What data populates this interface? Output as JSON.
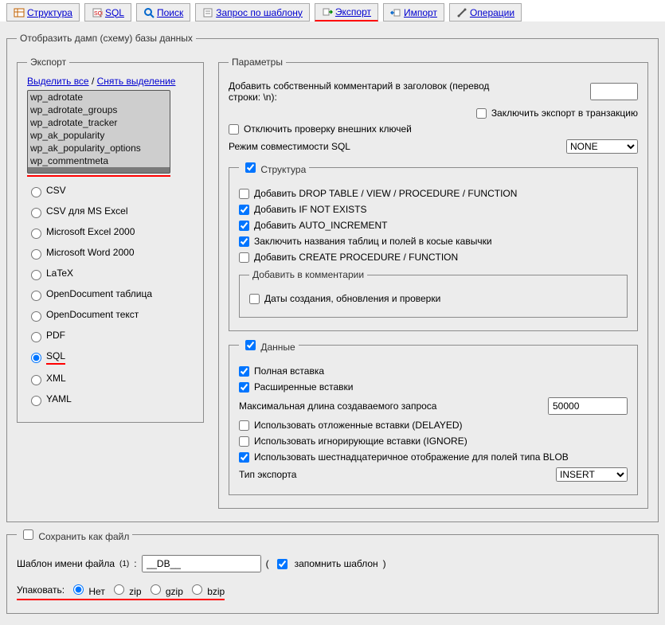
{
  "tabs": {
    "structure": "Структура",
    "sql": "SQL",
    "search": "Поиск",
    "template_query": "Запрос по шаблону",
    "export": "Экспорт",
    "import": "Импорт",
    "operations": "Операции"
  },
  "dump_legend": "Отобразить дамп (схему) базы данных",
  "export": {
    "legend": "Экспорт",
    "select_all": "Выделить все",
    "separator": "/",
    "deselect": "Снять выделение",
    "tables": [
      "wp_adrotate",
      "wp_adrotate_groups",
      "wp_adrotate_tracker",
      "wp_ak_popularity",
      "wp_ak_popularity_options",
      "wp_commentmeta"
    ],
    "formats": {
      "csv": "CSV",
      "csv_excel": "CSV для MS Excel",
      "excel2000": "Microsoft Excel 2000",
      "word2000": "Microsoft Word 2000",
      "latex": "LaTeX",
      "odt_table": "OpenDocument таблица",
      "odt_text": "OpenDocument текст",
      "pdf": "PDF",
      "sql": "SQL",
      "xml": "XML",
      "yaml": "YAML"
    }
  },
  "params": {
    "legend": "Параметры",
    "header_comment": "Добавить собственный комментарий в заголовок (перевод строки: \\n):",
    "wrap_transaction": "Заключить экспорт в транзакцию",
    "disable_fk": "Отключить проверку внешних ключей",
    "compat_label": "Режим совместимости SQL",
    "compat_value": "NONE",
    "structure": {
      "legend": "Структура",
      "drop": "Добавить DROP TABLE / VIEW / PROCEDURE / FUNCTION",
      "if_not_exists": "Добавить IF NOT EXISTS",
      "auto_inc": "Добавить AUTO_INCREMENT",
      "backquotes": "Заключить названия таблиц и полей в косые кавычки",
      "create_proc": "Добавить CREATE PROCEDURE / FUNCTION",
      "comments_legend": "Добавить в комментарии",
      "dates": "Даты создания, обновления и проверки"
    },
    "data": {
      "legend": "Данные",
      "full_insert": "Полная вставка",
      "extended_insert": "Расширенные вставки",
      "max_query_len": "Максимальная длина создаваемого запроса",
      "max_query_value": "50000",
      "delayed": "Использовать отложенные вставки (DELAYED)",
      "ignore": "Использовать игнорирующие вставки (IGNORE)",
      "hex_blob": "Использовать шестнадцатеричное отображение для полей типа BLOB",
      "export_type_label": "Тип экспорта",
      "export_type_value": "INSERT"
    }
  },
  "save": {
    "legend": "Сохранить как файл",
    "template_label": "Шаблон имени файла",
    "sup": "(1)",
    "template_value": "__DB__",
    "open_paren": "(",
    "remember": "запомнить шаблон",
    "close_paren": ")",
    "pack_label": "Упаковать:",
    "pack_none": "Нет",
    "pack_zip": "zip",
    "pack_gzip": "gzip",
    "pack_bzip": "bzip"
  }
}
